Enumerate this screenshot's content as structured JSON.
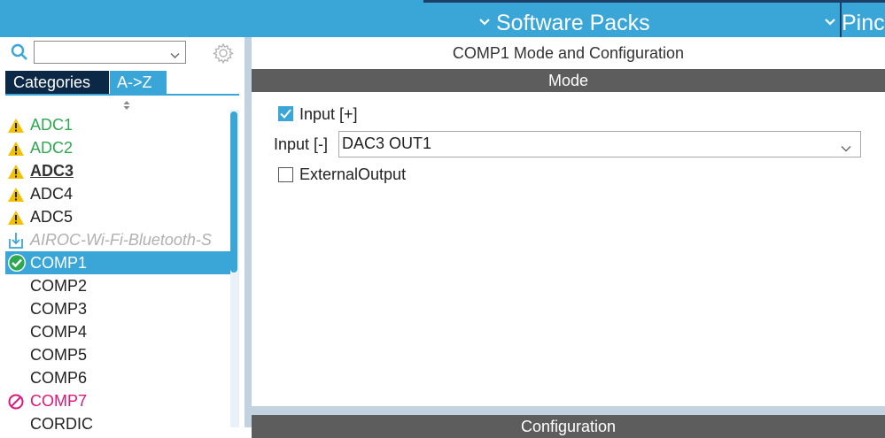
{
  "menu": {
    "software_packs": "Software Packs",
    "pinout": "Pinc"
  },
  "left_panel": {
    "search": {
      "value": ""
    },
    "tabs": {
      "categories": "Categories",
      "az": "A->Z"
    },
    "items": [
      {
        "label": "ADC1",
        "icon": "warning-icon"
      },
      {
        "label": "ADC2",
        "icon": "warning-icon"
      },
      {
        "label": "ADC3",
        "icon": "warning-icon"
      },
      {
        "label": "ADC4",
        "icon": "warning-icon"
      },
      {
        "label": "ADC5",
        "icon": "warning-icon"
      },
      {
        "label": "AIROC-Wi-Fi-Bluetooth-S",
        "icon": "download-icon"
      },
      {
        "label": "COMP1",
        "icon": "check-circle-icon",
        "selected": true
      },
      {
        "label": "COMP2"
      },
      {
        "label": "COMP3"
      },
      {
        "label": "COMP4"
      },
      {
        "label": "COMP5"
      },
      {
        "label": "COMP6"
      },
      {
        "label": "COMP7",
        "icon": "disabled-icon"
      },
      {
        "label": "CORDIC"
      }
    ]
  },
  "main": {
    "title": "COMP1 Mode and Configuration",
    "mode_header": "Mode",
    "input_plus": {
      "label": "Input [+]",
      "checked": true
    },
    "input_minus": {
      "label": "Input [-]",
      "value": "DAC3 OUT1"
    },
    "external_output": {
      "label": "ExternalOutput",
      "checked": false
    },
    "config_header": "Configuration"
  },
  "colors": {
    "accent": "#3aa6d8",
    "tab_dark": "#0b2847",
    "header_bar": "#5d5d5d",
    "warning": "#f2c200",
    "ok_green": "#2ea84e",
    "error_pink": "#e0157a"
  }
}
